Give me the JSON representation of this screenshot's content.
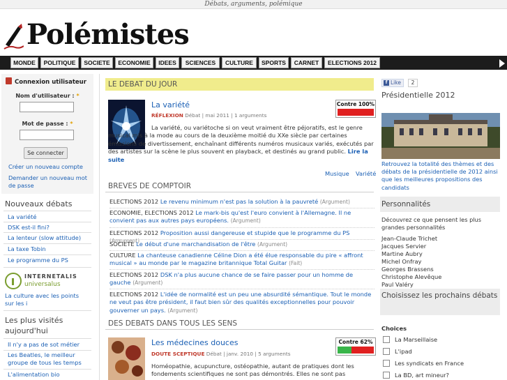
{
  "tagline": "Débats, arguments, polémique",
  "site_name": "Polémistes",
  "nav": [
    "MONDE",
    "POLITIQUE",
    "SOCIETE",
    "ECONOMIE",
    "IDEES",
    "SCIENCES",
    "CULTURE",
    "SPORTS",
    "CARNET",
    "ELECTIONS 2012"
  ],
  "login": {
    "title": "Connexion utilisateur",
    "username_label": "Nom d'utilisateur :",
    "password_label": "Mot de passe :",
    "required_mark": "*",
    "submit_label": "Se connecter",
    "links": [
      "Créer un nouveau compte",
      "Demander un nouveau mot de passe"
    ]
  },
  "new_debates": {
    "title": "Nouveaux débats",
    "items": [
      "La variété",
      "DSK est-il fini?",
      "La lenteur (slow attitude)",
      "La taxe Tobin",
      "Le programme du PS"
    ]
  },
  "internetalis": {
    "name": "INTERNETALIS",
    "sub": "universalus",
    "link": "La culture avec les points sur les i"
  },
  "most_visited": {
    "title": "Les plus visités aujourd'hui",
    "items": [
      "Il n'y a pas de sot métier",
      "Les Beatles, le meilleur groupe de tous les temps",
      "L'alimentation bio"
    ]
  },
  "debat_du_jour": {
    "heading": "LE DEBAT DU JOUR",
    "title": "La variété",
    "category": "RÉFLEXION",
    "meta": "Débat | mai 2011 | 1 arguments",
    "contre_label": "Contre 100%",
    "contre_pct": 100,
    "body": "La variété, ou variétoche si on veut vraiment être péjoratifs, est le genre musical mis à la mode au cours de la deuxième moitié du XXe siècle par certaines émissions de divertissement, enchaînant différents numéros musicaux variés, exécutés par des artistes sur la scène le plus souvent en playback, et destinés au grand public.",
    "read_more": "Lire la suite",
    "tags": [
      "Musique",
      "Variété"
    ]
  },
  "breves": {
    "heading": "BREVES DE COMPTOIR",
    "items": [
      {
        "cat": "ELECTIONS 2012",
        "text": "Le revenu minimum n'est pas la solution à la pauvreté",
        "type": "(Argument)"
      },
      {
        "cat": "ECONOMIE, ELECTIONS 2012",
        "text": "Le mark-bis qu'est l'euro convient à l'Allemagne. Il ne convient pas aux autres pays européens.",
        "type": "(Argument)"
      },
      {
        "cat": "ELECTIONS 2012",
        "text": "Proposition aussi dangereuse et stupide que le programme du PS",
        "type": "(Argument)"
      },
      {
        "cat": "SOCIETE",
        "text": "Le début d'une marchandisation de l'être",
        "type": "(Argument)"
      },
      {
        "cat": "CULTURE",
        "text": "La chanteuse canadienne Céline Dion a été élue responsable du pire « affront musical » au monde par le magazine britannique Total Guitar",
        "type": "(Fait)"
      },
      {
        "cat": "ELECTIONS 2012",
        "text": "DSK n'a plus aucune chance de se faire passer pour un homme de gauche",
        "type": "(Argument)"
      },
      {
        "cat": "ELECTIONS 2012",
        "text": "L'idée de normalité est un peu une absurdité sémantique. Tout le monde ne veut pas être président, il faut bien sûr des qualités exceptionnelles pour pouvoir gouverner un pays.",
        "type": "(Argument)"
      }
    ]
  },
  "all_debates": {
    "heading": "DES DEBATS DANS TOUS LES SENS",
    "title": "Les médecines douces",
    "category": "DOUTE SCEPTIQUE",
    "meta": "Débat | janv. 2010 | 5 arguments",
    "contre_label": "Contre 62%",
    "contre_pct": 62,
    "body": "Homéopathie, acupuncture, ostéopathie, autant de pratiques dont les fondements scientifiques ne sont pas démontrés. Elles ne sont pas enseignées dans des cursus"
  },
  "right": {
    "fb_like": "Like",
    "fb_count": "2",
    "presidentielle_title": "Présidentielle 2012",
    "presidentielle_link": "Retrouvez la totalité des thèmes et des débats de la présidentielle de 2012 ainsi que les meilleures propositions des candidats",
    "personnalites_title": "Personnalités",
    "personnalites_intro": "Découvrez ce que pensent les plus grandes personnalités",
    "people": [
      "Jean-Claude Trichet",
      "Jacques Servier",
      "Martine Aubry",
      "Michel Onfray",
      "Georges Brassens",
      "Christophe Alevêque",
      "Paul Valéry"
    ],
    "choose_title": "Choisissez les prochains débats",
    "choices_label": "Choices",
    "choices": [
      "La Marseillaise",
      "L'ipad",
      "Les syndicats en France",
      "La BD, art mineur?"
    ]
  },
  "colors": {
    "nav_bg": "#1c1c1c",
    "debate_head": "#f0ec8c",
    "contre_red": "#e02020",
    "pour_green": "#39b54a",
    "link": "#1a5fb4"
  }
}
